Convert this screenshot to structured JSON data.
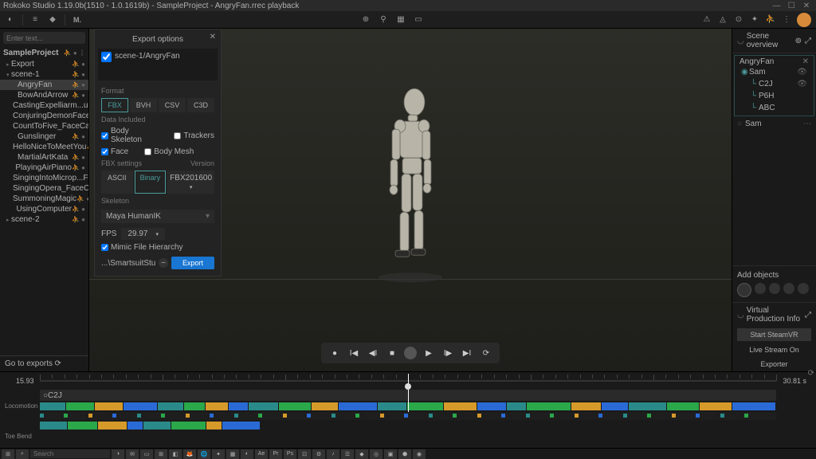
{
  "titlebar": {
    "text": "Rokoko Studio 1.19.0b(1510 - 1.0.1619b) - SampleProject - AngryFan.rrec playback"
  },
  "search": {
    "placeholder": "Enter text..."
  },
  "project": {
    "name": "SampleProject",
    "tree": [
      {
        "label": "Export",
        "lvl": "l1",
        "exp": "▸"
      },
      {
        "label": "scene-1",
        "lvl": "l1",
        "exp": "▾"
      },
      {
        "label": "AngryFan",
        "lvl": "l2",
        "sel": true
      },
      {
        "label": "BowAndArrow",
        "lvl": "l2"
      },
      {
        "label": "CastingExpelliarm...ucaCap",
        "lvl": "l2"
      },
      {
        "label": "ConjuringDemonFaceCap",
        "lvl": "l2"
      },
      {
        "label": "CountToFive_FaceCap",
        "lvl": "l2"
      },
      {
        "label": "Gunslinger",
        "lvl": "l2"
      },
      {
        "label": "HelloNiceToMeetYou",
        "lvl": "l2"
      },
      {
        "label": "MartialArtKata",
        "lvl": "l2"
      },
      {
        "label": "PlayingAirPiano",
        "lvl": "l2"
      },
      {
        "label": "SingingIntoMicrop...Face",
        "lvl": "l2"
      },
      {
        "label": "SingingOpera_FaceCap",
        "lvl": "l2"
      },
      {
        "label": "SummoningMagic",
        "lvl": "l2"
      },
      {
        "label": "UsingComputer",
        "lvl": "l2"
      },
      {
        "label": "scene-2",
        "lvl": "l1",
        "exp": "▸"
      }
    ]
  },
  "goexp": "Go to exports",
  "export": {
    "title": "Export options",
    "scene": "scene-1/AngryFan",
    "sect_format": "Format",
    "formats": [
      "FBX",
      "BVH",
      "CSV",
      "C3D"
    ],
    "format_active": "FBX",
    "sect_data": "Data Included",
    "chk_body": "Body Skeleton",
    "chk_face": "Face",
    "chk_trackers": "Trackers",
    "chk_bodymesh": "Body Mesh",
    "sect_fbx": "FBX settings",
    "sect_ver": "Version",
    "fbxmodes": [
      "ASCII",
      "Binary"
    ],
    "fbx_active": "Binary",
    "version": "FBX201600",
    "sect_skel": "Skeleton",
    "skeleton": "Maya HumanIK",
    "fps_lbl": "FPS",
    "fps": "29.97",
    "mimic": "Mimic File Hierarchy",
    "path": "...\\SmartsuitStudioProjects",
    "btn": "Export"
  },
  "scene": {
    "title": "Scene overview",
    "grp": "AngryFan",
    "items": [
      {
        "label": "Sam",
        "lvl": "l1",
        "eye": true
      },
      {
        "label": "C2J",
        "lvl": "l2",
        "eye": true
      },
      {
        "label": "P6H",
        "lvl": "l2"
      },
      {
        "label": "ABC",
        "lvl": "l2"
      }
    ],
    "muted": "Sam"
  },
  "addobj": "Add objects",
  "vp": {
    "title": "Virtual Production Info",
    "start": "Start SteamVR",
    "live": "Live Stream On",
    "exporter": "Exporter"
  },
  "timeline": {
    "now": "15.93",
    "end": "30.81 s",
    "clip": "C2J",
    "track1": "Locomotion",
    "track2": "Toe Bend"
  },
  "taskbar": {
    "search": "Search"
  }
}
